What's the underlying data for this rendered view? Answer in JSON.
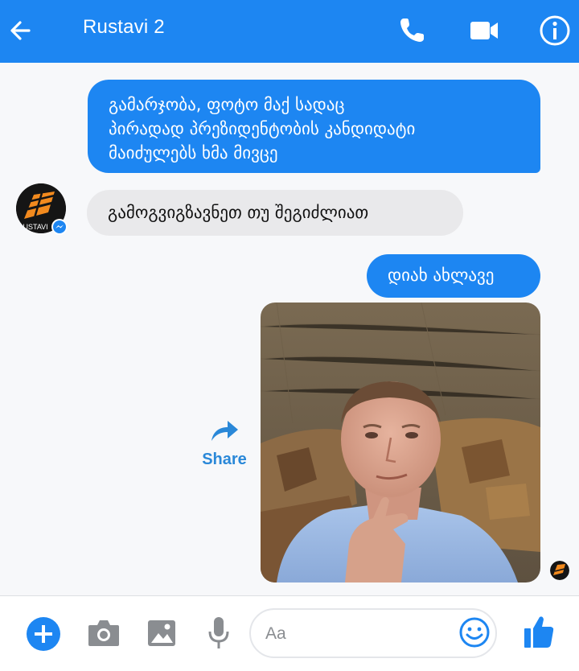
{
  "header": {
    "title": "Rustavi 2",
    "back_icon": "arrow-left-icon",
    "call_icon": "phone-icon",
    "video_icon": "video-camera-icon",
    "info_icon": "info-icon",
    "bg_color": "#1d86f2"
  },
  "messages": {
    "m1_lines": [
      "გამარჯობა, ფოტო მაქ სადაც",
      "პირადად პრეზიდენტობის კანდიდატი",
      "მაიძულებს ხმა მივცე"
    ],
    "m2": "გამოგვიგზავნეთ თუ შეგიძლიათ",
    "m3": "დიახ ახლავე",
    "photo_desc_icon": "photo-attachment",
    "share_label": "Share",
    "avatar_text": "RUSTAVI"
  },
  "composer": {
    "placeholder": "Aa",
    "add_icon": "plus-circle-icon",
    "camera_icon": "camera-icon",
    "gallery_icon": "image-icon",
    "mic_icon": "microphone-icon",
    "emoji_icon": "emoji-icon",
    "like_icon": "thumbs-up-icon"
  }
}
